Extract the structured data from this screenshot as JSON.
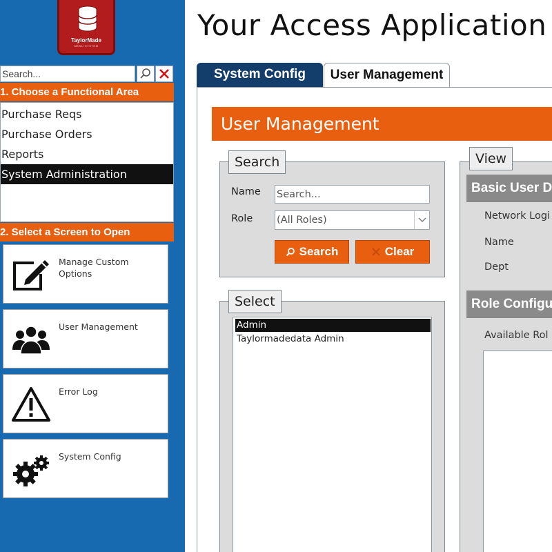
{
  "window": {
    "title": "Your Access Application"
  },
  "logo": {
    "name": "TaylorMade",
    "sub": "MENU SYSTEM"
  },
  "sidebar": {
    "search_placeholder": "Search...",
    "section1_title": "1.  Choose a Functional Area",
    "areas": [
      {
        "label": "Purchase Reqs",
        "selected": false
      },
      {
        "label": "Purchase Orders",
        "selected": false
      },
      {
        "label": "Reports",
        "selected": false
      },
      {
        "label": "System Administration",
        "selected": true
      }
    ],
    "section2_title": "2.  Select a Screen to Open",
    "screens": [
      {
        "label": "Manage Custom Options",
        "icon": "edit-icon"
      },
      {
        "label": "User Management",
        "icon": "users-icon"
      },
      {
        "label": "Error Log",
        "icon": "warning-icon"
      },
      {
        "label": "System Config",
        "icon": "gears-icon"
      }
    ]
  },
  "tabs": [
    {
      "label": "System Config",
      "active": false
    },
    {
      "label": "User Management",
      "active": true
    }
  ],
  "panel": {
    "banner": "User Management",
    "search_group": {
      "legend": "Search",
      "name_label": "Name",
      "name_placeholder": "Search...",
      "role_label": "Role",
      "role_value": "(All Roles)",
      "search_button": "Search",
      "clear_button": "Clear"
    },
    "select_group": {
      "legend": "Select",
      "items": [
        {
          "label": "Admin",
          "selected": true
        },
        {
          "label": "Taylormadedata Admin",
          "selected": false
        }
      ]
    },
    "view_group": {
      "legend": "View",
      "basic_head": "Basic User D",
      "network_label": "Network Logi",
      "name_label": "Name",
      "dept_label": "Dept",
      "role_head": "Role Configu",
      "available_label": "Available Rol"
    }
  },
  "colors": {
    "sidebar_blue": "#1769b0",
    "accent_orange": "#e85f10",
    "tab_navy": "#133e6b",
    "group_grey": "#dcdcdc",
    "header_grey": "#8a8a8a"
  }
}
